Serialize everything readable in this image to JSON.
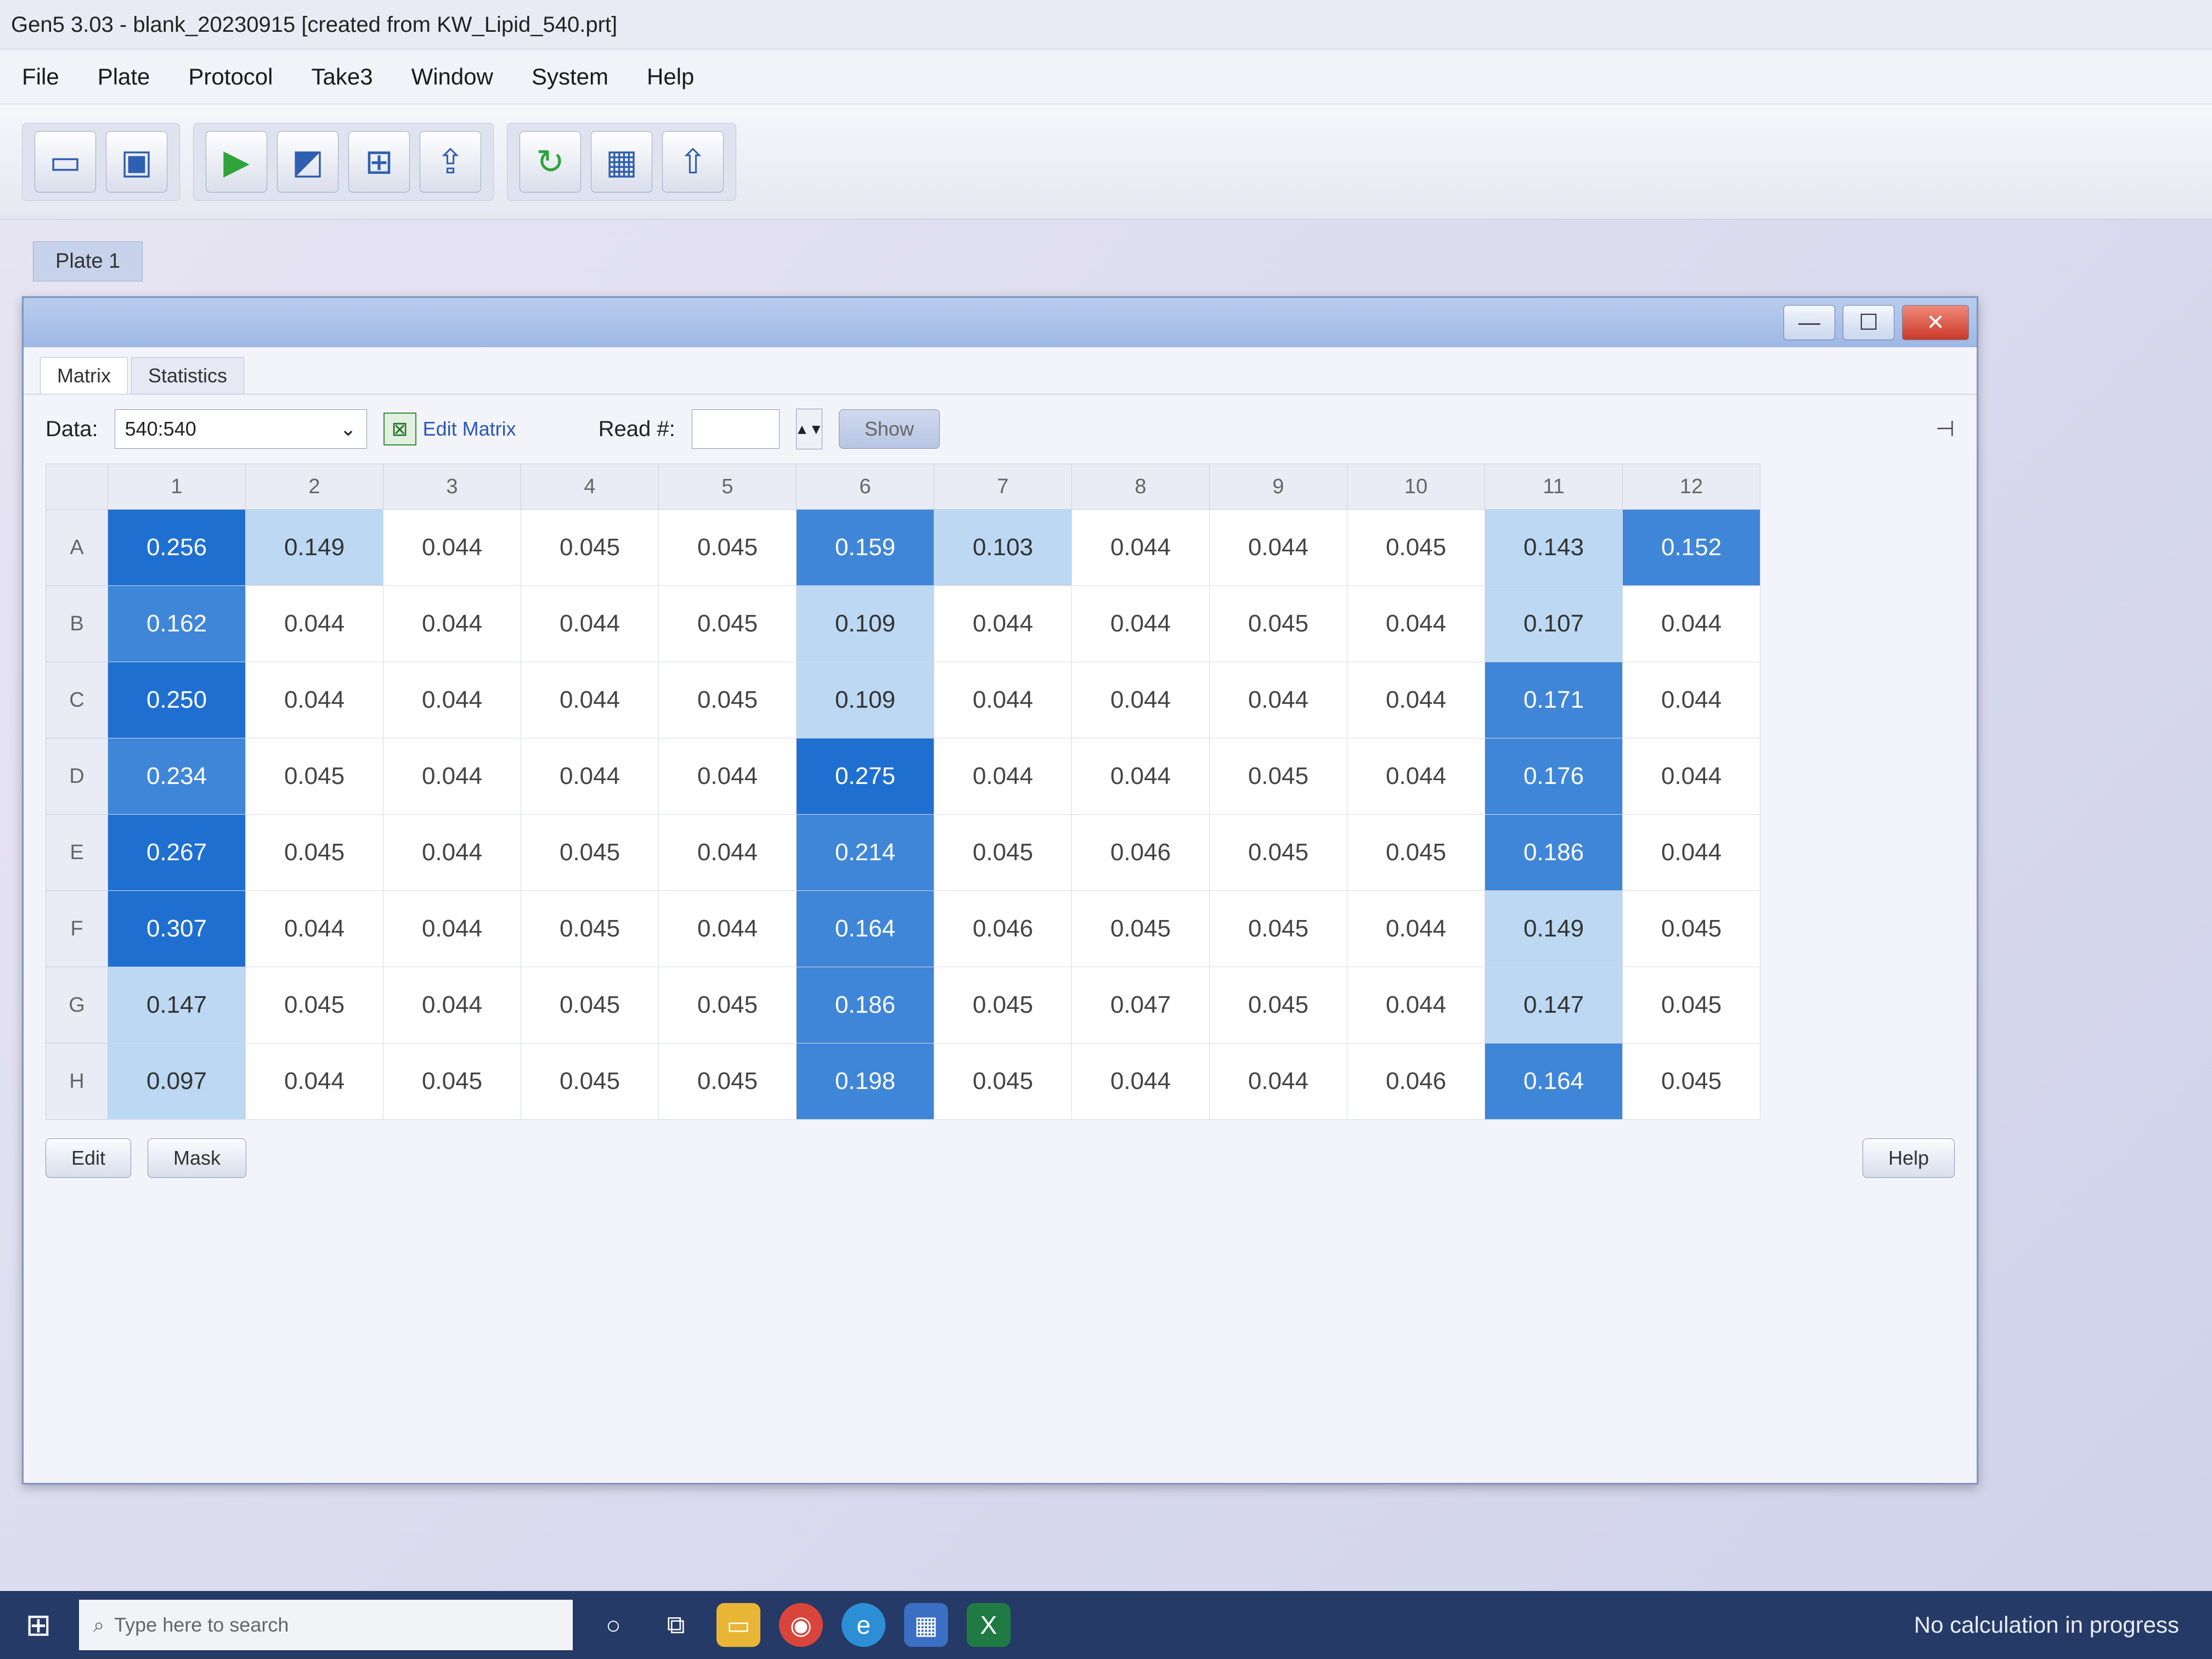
{
  "app": {
    "title": "Gen5 3.03 - blank_20230915 [created from KW_Lipid_540.prt]"
  },
  "menu": [
    "File",
    "Plate",
    "Protocol",
    "Take3",
    "Window",
    "System",
    "Help"
  ],
  "toolbar": {
    "icons": [
      "new-icon",
      "save-icon",
      "run-icon",
      "chart-icon",
      "plate-icon",
      "export-icon",
      "refresh-icon",
      "grid-icon",
      "upload-icon"
    ]
  },
  "plate_tab": {
    "label": "Plate 1"
  },
  "child": {
    "tabs": [
      "Matrix",
      "Statistics"
    ],
    "data_label": "Data:",
    "data_value": "540:540",
    "edit_matrix_label": "Edit Matrix",
    "read_label": "Read #:",
    "read_value": "",
    "show_label": "Show",
    "edit_label": "Edit",
    "mask_label": "Mask",
    "help_label": "Help"
  },
  "plate": {
    "columns": [
      "1",
      "2",
      "3",
      "4",
      "5",
      "6",
      "7",
      "8",
      "9",
      "10",
      "11",
      "12"
    ],
    "rows": [
      {
        "label": "A",
        "values": [
          "0.256",
          "0.149",
          "0.044",
          "0.045",
          "0.045",
          "0.159",
          "0.103",
          "0.044",
          "0.044",
          "0.045",
          "0.143",
          "0.152"
        ]
      },
      {
        "label": "B",
        "values": [
          "0.162",
          "0.044",
          "0.044",
          "0.044",
          "0.045",
          "0.109",
          "0.044",
          "0.044",
          "0.045",
          "0.044",
          "0.107",
          "0.044"
        ]
      },
      {
        "label": "C",
        "values": [
          "0.250",
          "0.044",
          "0.044",
          "0.044",
          "0.045",
          "0.109",
          "0.044",
          "0.044",
          "0.044",
          "0.044",
          "0.171",
          "0.044"
        ]
      },
      {
        "label": "D",
        "values": [
          "0.234",
          "0.045",
          "0.044",
          "0.044",
          "0.044",
          "0.275",
          "0.044",
          "0.044",
          "0.045",
          "0.044",
          "0.176",
          "0.044"
        ]
      },
      {
        "label": "E",
        "values": [
          "0.267",
          "0.045",
          "0.044",
          "0.045",
          "0.044",
          "0.214",
          "0.045",
          "0.046",
          "0.045",
          "0.045",
          "0.186",
          "0.044"
        ]
      },
      {
        "label": "F",
        "values": [
          "0.307",
          "0.044",
          "0.044",
          "0.045",
          "0.044",
          "0.164",
          "0.046",
          "0.045",
          "0.045",
          "0.044",
          "0.149",
          "0.045"
        ]
      },
      {
        "label": "G",
        "values": [
          "0.147",
          "0.045",
          "0.044",
          "0.045",
          "0.045",
          "0.186",
          "0.045",
          "0.047",
          "0.045",
          "0.044",
          "0.147",
          "0.045"
        ]
      },
      {
        "label": "H",
        "values": [
          "0.097",
          "0.044",
          "0.045",
          "0.045",
          "0.045",
          "0.198",
          "0.045",
          "0.044",
          "0.044",
          "0.046",
          "0.164",
          "0.045"
        ]
      }
    ],
    "heat_colors": {
      "low": "#ffffff",
      "mid": "#bcd8f2",
      "high": "#3f86d8",
      "top": "#1f6fd1"
    }
  },
  "taskbar": {
    "search_placeholder": "Type here to search",
    "status": "No calculation in progress"
  }
}
